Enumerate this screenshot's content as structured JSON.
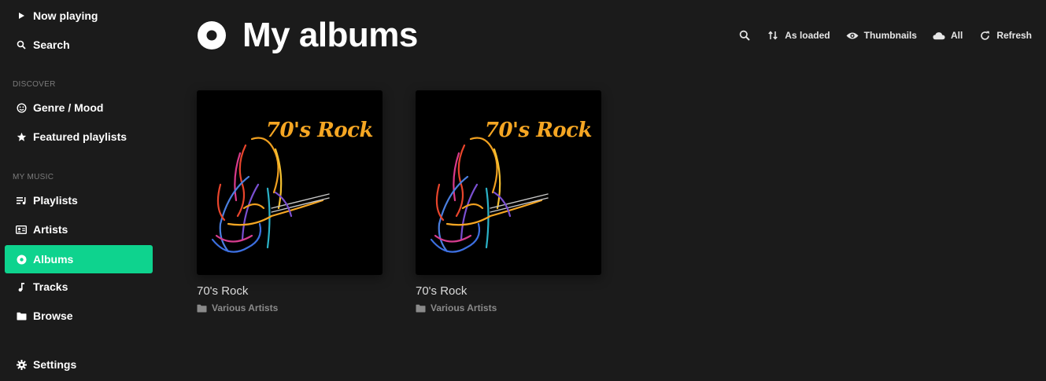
{
  "sidebar": {
    "now_playing": "Now playing",
    "search": "Search",
    "discover_label": "DISCOVER",
    "genre_mood": "Genre / Mood",
    "featured_playlists": "Featured playlists",
    "my_music_label": "MY MUSIC",
    "playlists": "Playlists",
    "artists": "Artists",
    "albums": "Albums",
    "tracks": "Tracks",
    "browse": "Browse",
    "settings": "Settings",
    "active_item": "Albums",
    "active_color": "#0ed38e"
  },
  "header": {
    "title": "My albums",
    "title_icon": "disc-icon"
  },
  "toolbar": {
    "search_icon": "search-icon",
    "sort_label": "As loaded",
    "view_label": "Thumbnails",
    "source_label": "All",
    "refresh_label": "Refresh"
  },
  "albums": [
    {
      "title": "70's Rock",
      "artist": "Various Artists",
      "art_text": "70's Rock"
    },
    {
      "title": "70's Rock",
      "artist": "Various Artists",
      "art_text": "70's Rock"
    }
  ]
}
